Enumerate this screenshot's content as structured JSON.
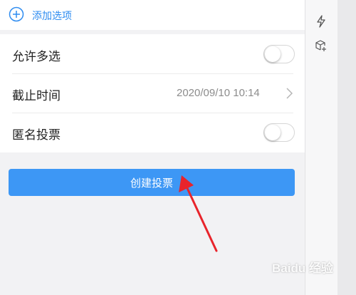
{
  "add_option": {
    "label": "添加选项",
    "icon": "plus-circle-icon"
  },
  "settings": {
    "allow_multiple": {
      "label": "允许多选",
      "enabled": false
    },
    "deadline": {
      "label": "截止时间",
      "value": "2020/09/10 10:14"
    },
    "anonymous": {
      "label": "匿名投票",
      "enabled": false
    }
  },
  "create_button": {
    "label": "创建投票",
    "color": "#3d97f5"
  },
  "rail": {
    "icons": [
      "lightning-icon",
      "cube-plus-icon"
    ]
  },
  "annotation": {
    "arrow_color": "#e8242b"
  },
  "watermark": {
    "text": "Baidu 经验"
  }
}
